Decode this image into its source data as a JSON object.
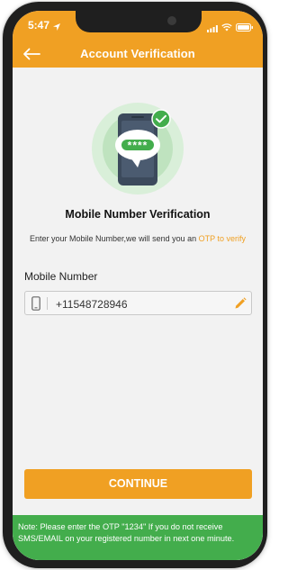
{
  "status_bar": {
    "time": "5:47"
  },
  "header": {
    "title": "Account Verification"
  },
  "verification": {
    "heading": "Mobile Number  Verification",
    "otp_mask": "****",
    "description_prefix": "Enter your Mobile Number,we will send you an ",
    "description_otp": "OTP",
    "description_suffix": " to verify"
  },
  "mobile_field": {
    "label": "Mobile Number",
    "value": "+11548728946"
  },
  "continue_button": {
    "label": "CONTINUE"
  },
  "note": {
    "text": "Note: Please enter the OTP \"1234\" If you do not receive SMS/EMAIL on your registered number in next one minute."
  },
  "colors": {
    "accent": "#f0a023",
    "success_green": "#43ad4c",
    "background": "#f2f2f2"
  },
  "icons": [
    "back-arrow-icon",
    "location-arrow-icon",
    "signal-icon",
    "wifi-icon",
    "battery-icon",
    "phone-otp-illustration",
    "check-badge-icon",
    "mobile-phone-icon",
    "pencil-edit-icon"
  ]
}
